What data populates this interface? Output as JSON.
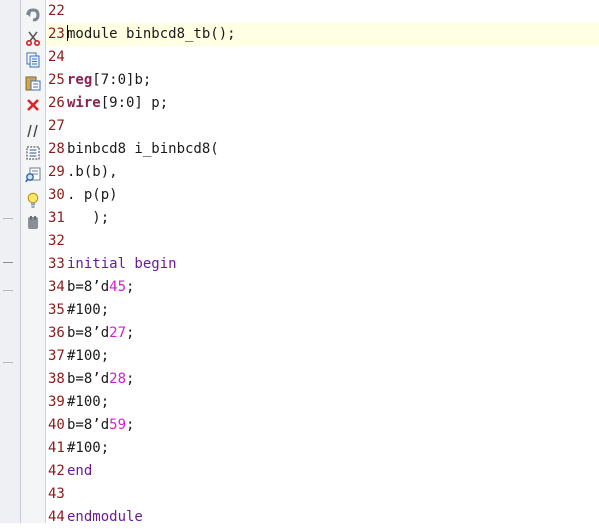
{
  "toolbar": {
    "icons": [
      "undo-icon",
      "cut-icon",
      "copy-icon",
      "paste-icon",
      "delete-icon",
      "comment-icon",
      "select-block-icon",
      "find-icon",
      "lightbulb-icon",
      "stamp-icon"
    ]
  },
  "colors": {
    "line_number": "#8b1a1a",
    "keyword": "#8b2252",
    "keyword2": "#6a1b9a",
    "number": "#d020d0",
    "current_line_bg": "#ffffe4"
  },
  "editor": {
    "lines": [
      {
        "n": "22",
        "parts": []
      },
      {
        "n": "23",
        "parts": [
          {
            "t": "module binbcd8_tb();"
          }
        ]
      },
      {
        "n": "24",
        "parts": []
      },
      {
        "n": "25",
        "parts": [
          {
            "t": "reg",
            "c": "kw"
          },
          {
            "t": "[7:0]b;"
          }
        ]
      },
      {
        "n": "26",
        "parts": [
          {
            "t": "wire",
            "c": "kw"
          },
          {
            "t": "[9:0] p;"
          }
        ]
      },
      {
        "n": "27",
        "parts": []
      },
      {
        "n": "28",
        "parts": [
          {
            "t": "binbcd8 i_binbcd8("
          }
        ]
      },
      {
        "n": "29",
        "parts": [
          {
            "t": ".b(b),"
          }
        ]
      },
      {
        "n": "30",
        "parts": [
          {
            "t": ". p(p)"
          }
        ]
      },
      {
        "n": "31",
        "parts": [
          {
            "t": "   );"
          }
        ]
      },
      {
        "n": "32",
        "parts": []
      },
      {
        "n": "33",
        "parts": [
          {
            "t": "initial begin",
            "c": "kw2"
          }
        ]
      },
      {
        "n": "34",
        "parts": [
          {
            "t": "b=8’d"
          },
          {
            "t": "45",
            "c": "num"
          },
          {
            "t": ";"
          }
        ]
      },
      {
        "n": "35",
        "parts": [
          {
            "t": "#100;"
          }
        ]
      },
      {
        "n": "36",
        "parts": [
          {
            "t": "b=8’d"
          },
          {
            "t": "27",
            "c": "num"
          },
          {
            "t": ";"
          }
        ]
      },
      {
        "n": "37",
        "parts": [
          {
            "t": "#100;"
          }
        ]
      },
      {
        "n": "38",
        "parts": [
          {
            "t": "b=8’d"
          },
          {
            "t": "28",
            "c": "num"
          },
          {
            "t": ";"
          }
        ]
      },
      {
        "n": "39",
        "parts": [
          {
            "t": "#100;"
          }
        ]
      },
      {
        "n": "40",
        "parts": [
          {
            "t": "b=8’d"
          },
          {
            "t": "59",
            "c": "num"
          },
          {
            "t": ";"
          }
        ]
      },
      {
        "n": "41",
        "parts": [
          {
            "t": "#100;"
          }
        ]
      },
      {
        "n": "42",
        "parts": [
          {
            "t": "end",
            "c": "kw2"
          }
        ]
      },
      {
        "n": "43",
        "parts": []
      },
      {
        "n": "44",
        "parts": [
          {
            "t": "endmodule",
            "c": "kw2"
          }
        ]
      }
    ]
  }
}
